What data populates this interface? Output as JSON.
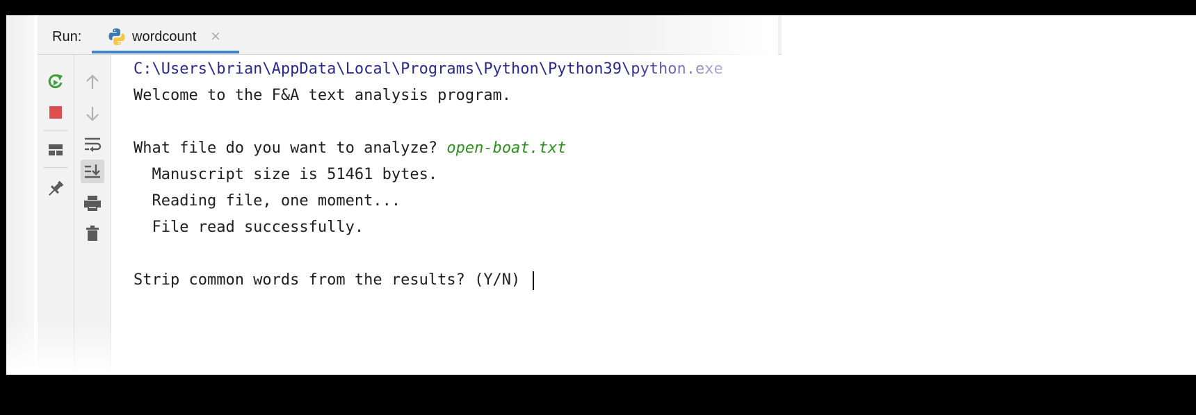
{
  "run_panel": {
    "run_label": "Run:",
    "tab": {
      "label": "wordcount",
      "close": "×",
      "icon": "python-icon"
    }
  },
  "toolbar_outer": [
    {
      "name": "rerun-icon",
      "color": "#3f9e3a"
    },
    {
      "name": "stop-icon",
      "color": "#db4f4f"
    },
    {
      "name": "layout-icon",
      "color": "#5a5a5a"
    },
    {
      "name": "pin-icon",
      "color": "#5a5a5a"
    }
  ],
  "toolbar_inner": [
    {
      "name": "up-arrow-icon",
      "color": "#b0b0b0"
    },
    {
      "name": "down-arrow-icon",
      "color": "#b0b0b0"
    },
    {
      "name": "soft-wrap-icon",
      "color": "#5a5a5a"
    },
    {
      "name": "scroll-to-end-icon",
      "color": "#5a5a5a",
      "active": true
    },
    {
      "name": "print-icon",
      "color": "#5a5a5a"
    },
    {
      "name": "trash-icon",
      "color": "#5a5a5a"
    }
  ],
  "console": {
    "command_line": "C:\\Users\\brian\\AppData\\Local\\Programs\\Python\\Python39\\python.exe",
    "welcome": "Welcome to the F&A text analysis program.",
    "prompt_file": "What file do you want to analyze? ",
    "input_file": "open-boat.txt",
    "manuscript_size": "  Manuscript size is 51461 bytes.",
    "reading": "  Reading file, one moment...",
    "read_success": "  File read successfully.",
    "prompt_strip": "Strip common words from the results? (Y/N) "
  },
  "colors": {
    "tab_underline": "#4083c9",
    "input_text": "#2f8f1f",
    "command_text": "#2a2a8a"
  }
}
